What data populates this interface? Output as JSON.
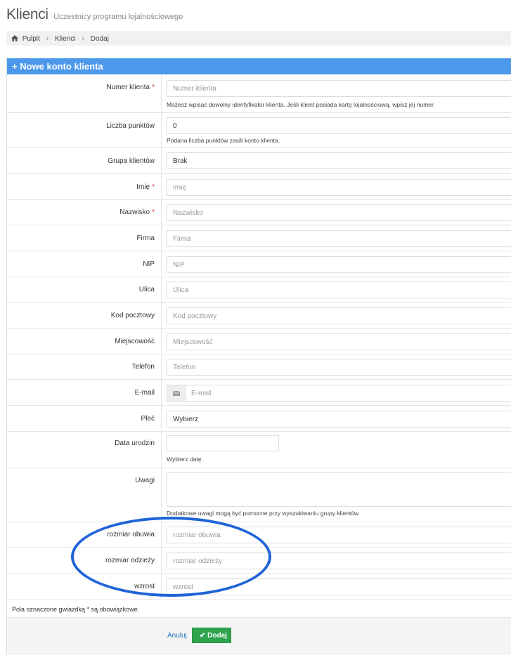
{
  "header": {
    "title": "Klienci",
    "subtitle": "Uczestnicy programu lojalnościowego"
  },
  "breadcrumb": [
    "Pulpit",
    "Klienci",
    "Dodaj"
  ],
  "panel": {
    "heading": "+ Nowe konto klienta"
  },
  "fields": {
    "client_number": {
      "label": "Numer klienta",
      "placeholder": "Numer klienta",
      "help": "Możesz wpisać dowolny identyfikator klienta. Jeśli klient posiada kartę lojalnościową, wpisz jej numer."
    },
    "points": {
      "label": "Liczba punktów",
      "value": "0",
      "help": "Podana liczba punktów zasili konto klienta."
    },
    "group": {
      "label": "Grupa klientów",
      "value": "Brak"
    },
    "first_name": {
      "label": "Imię",
      "placeholder": "Imię"
    },
    "last_name": {
      "label": "Nazwisko",
      "placeholder": "Nazwisko"
    },
    "company": {
      "label": "Firma",
      "placeholder": "Firma"
    },
    "nip": {
      "label": "NIP",
      "placeholder": "NIP"
    },
    "street": {
      "label": "Ulica",
      "placeholder": "Ulica"
    },
    "postal_code": {
      "label": "Kod pocztowy",
      "placeholder": "Kod pocztowy"
    },
    "city": {
      "label": "Miejscowość",
      "placeholder": "Miejscowość"
    },
    "phone": {
      "label": "Telefon",
      "placeholder": "Telefon"
    },
    "email": {
      "label": "E-mail",
      "placeholder": "E-mail"
    },
    "gender": {
      "label": "Płeć",
      "value": "Wybierz"
    },
    "birth_date": {
      "label": "Data urodzin",
      "help": "Wybierz datę."
    },
    "notes": {
      "label": "Uwagi",
      "help": "Dodatkowe uwagi mogą być pomocne przy wyszukiwaniu grupy klientów."
    },
    "shoe_size": {
      "label": "rozmiar obuwia",
      "placeholder": "rozmiar obuwia"
    },
    "clothing_size": {
      "label": "rozmiar odzieży",
      "placeholder": "rozmiar odzieży"
    },
    "height": {
      "label": "wzrost",
      "placeholder": "wzrost"
    }
  },
  "required_marker": "*",
  "footer_note": "Pola oznaczone gwiazdką * są obowiązkowe.",
  "actions": {
    "cancel": "Anuluj",
    "submit": "Dodaj"
  },
  "colors": {
    "panel_heading": "#4c98ea",
    "submit": "#2ea44f",
    "annotation": "#1f63d8"
  }
}
